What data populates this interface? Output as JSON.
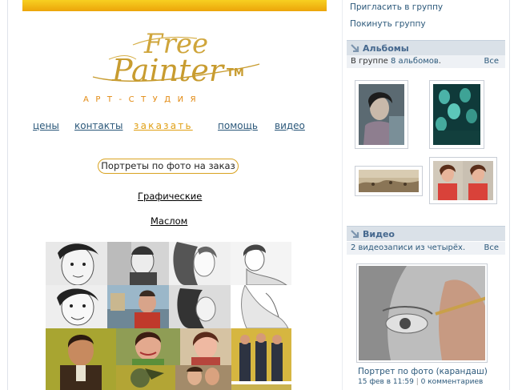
{
  "logo": {
    "word1": "Free",
    "word2": "Painter",
    "tm": "TM",
    "subtitle": "АРТ-СТУДИЯ"
  },
  "nav": {
    "prices": "цены",
    "contacts": "контакты",
    "order": "заказать",
    "help": "помощь",
    "video": "видео"
  },
  "main": {
    "portrait_button": "Портреты по фото на заказ",
    "link_graphic": "Графические",
    "link_oil": "Маслом"
  },
  "sidebar": {
    "invite": "Пригласить в группу",
    "leave": "Покинуть группу",
    "albums": {
      "title": "Альбомы",
      "summary_prefix": "В группе ",
      "summary_link": "8 альбомов",
      "summary_suffix": ".",
      "all": "Все"
    },
    "video": {
      "title": "Видео",
      "summary": "2 видеозаписи из четырёх.",
      "all": "Все",
      "item_title": "Портрет по фото (карандаш)",
      "item_date": "15 фев в 11:59",
      "item_separator": "|",
      "item_comments": "0 комментариев"
    }
  },
  "colors": {
    "link_blue": "#2b587a",
    "header_bg": "#dae1e8",
    "accent_gold": "#e0a015",
    "banner_yellow": "#f2c417"
  },
  "icons": {
    "section_arrow": "down-right-arrow-icon"
  }
}
